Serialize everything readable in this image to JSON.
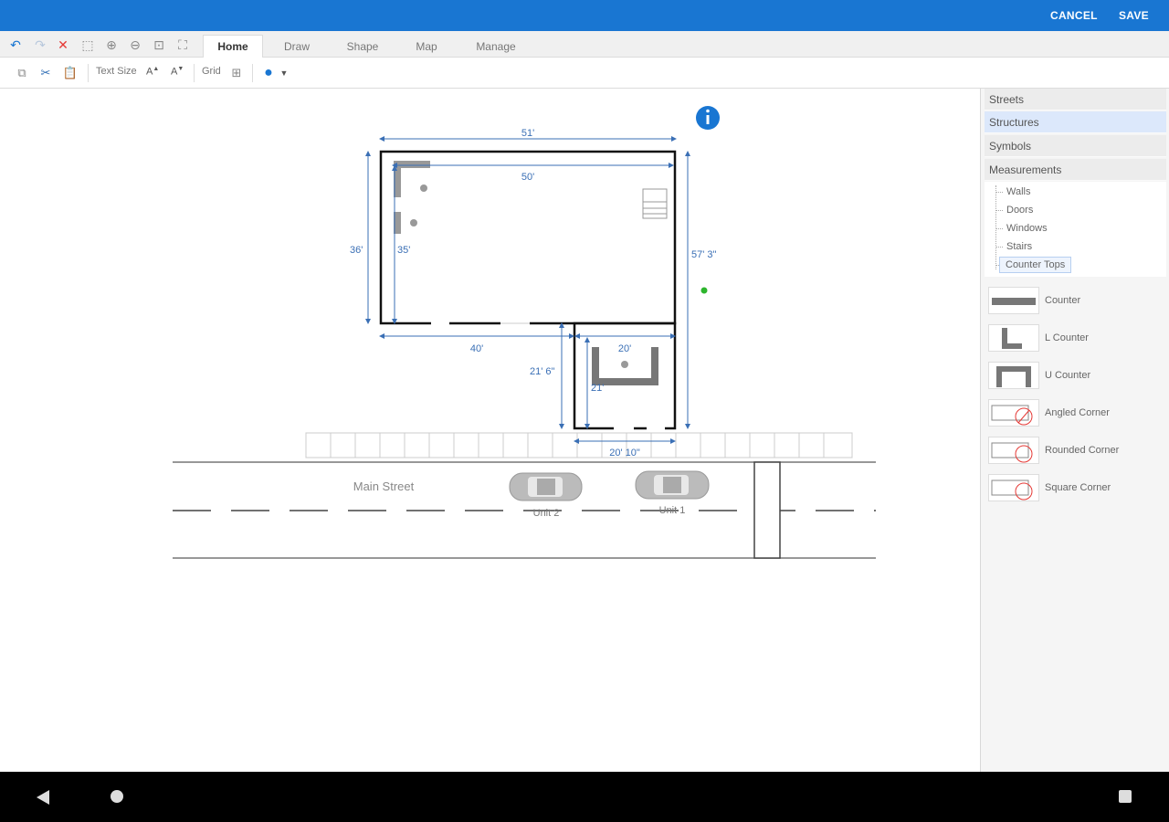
{
  "header": {
    "cancel_label": "CANCEL",
    "save_label": "SAVE"
  },
  "ribbon": {
    "tabs": [
      {
        "label": "Home",
        "active": true
      },
      {
        "label": "Draw",
        "active": false
      },
      {
        "label": "Shape",
        "active": false
      },
      {
        "label": "Map",
        "active": false
      },
      {
        "label": "Manage",
        "active": false
      }
    ],
    "quick_icons": [
      "undo-icon",
      "redo-icon",
      "delete-icon",
      "select-area-icon",
      "zoom-in-icon",
      "zoom-out-icon",
      "zoom-fit-icon",
      "fit-page-icon"
    ],
    "tools": {
      "text_size_label": "Text Size",
      "increase_label": "A",
      "decrease_label": "A",
      "grid_label": "Grid"
    }
  },
  "drawing": {
    "dimensions": {
      "top_outer": "51'",
      "top_inner": "50'",
      "left_outer": "36'",
      "left_inner": "35'",
      "right_outer": "57' 3\"",
      "bottom_left": "40'",
      "annex_top": "20'",
      "annex_left": "21' 6\"",
      "annex_inner": "21'",
      "annex_bottom": "20' 10\""
    },
    "street_label": "Main Street",
    "units": [
      {
        "label": "Unit 2"
      },
      {
        "label": "Unit 1"
      }
    ]
  },
  "panel": {
    "categories": [
      {
        "label": "Streets",
        "selected": false
      },
      {
        "label": "Structures",
        "selected": true
      },
      {
        "label": "Symbols",
        "selected": false
      },
      {
        "label": "Measurements",
        "selected": false
      }
    ],
    "tree_items": [
      {
        "label": "Walls",
        "selected": false
      },
      {
        "label": "Doors",
        "selected": false
      },
      {
        "label": "Windows",
        "selected": false
      },
      {
        "label": "Stairs",
        "selected": false
      },
      {
        "label": "Counter Tops",
        "selected": true
      }
    ],
    "stencils": [
      {
        "label": "Counter",
        "icon": "counter-icon"
      },
      {
        "label": "L Counter",
        "icon": "l-counter-icon"
      },
      {
        "label": "U Counter",
        "icon": "u-counter-icon"
      },
      {
        "label": "Angled Corner",
        "icon": "angled-corner-icon"
      },
      {
        "label": "Rounded Corner",
        "icon": "rounded-corner-icon"
      },
      {
        "label": "Square Corner",
        "icon": "square-corner-icon"
      }
    ]
  },
  "colors": {
    "accent": "#1976d2",
    "dimension": "#3a6fb5",
    "wall": "#111111"
  }
}
